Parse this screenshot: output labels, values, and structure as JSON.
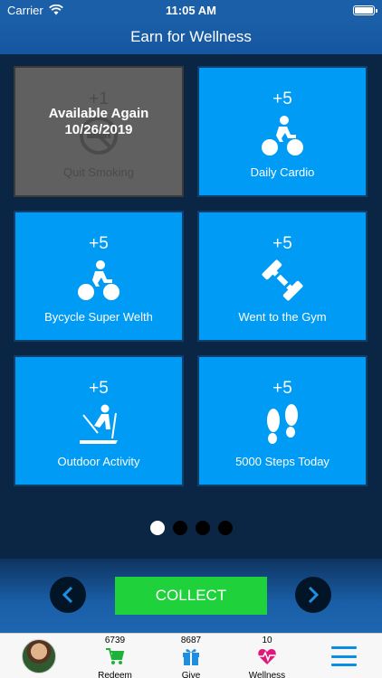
{
  "status_bar": {
    "carrier": "Carrier",
    "time": "11:05 AM"
  },
  "header": {
    "title": "Earn for Wellness"
  },
  "cards": [
    {
      "points": "+1",
      "label": "Quit Smoking",
      "icon": "no-smoking-icon",
      "overlay_line1": "Available Again",
      "overlay_line2": "10/26/2019",
      "disabled": true
    },
    {
      "points": "+5",
      "label": "Daily Cardio",
      "icon": "cycling-icon"
    },
    {
      "points": "+5",
      "label": "Bycycle Super Welth",
      "icon": "cycling-icon"
    },
    {
      "points": "+5",
      "label": "Went to the Gym",
      "icon": "dumbbell-icon"
    },
    {
      "points": "+5",
      "label": "Outdoor Activity",
      "icon": "skiing-icon"
    },
    {
      "points": "+5",
      "label": "5000 Steps Today",
      "icon": "footprints-icon"
    }
  ],
  "pagination": {
    "pages": 4,
    "current": 1
  },
  "controls": {
    "collect_label": "COLLECT"
  },
  "tabbar": {
    "redeem": {
      "count": "6739",
      "label": "Redeem",
      "icon": "cart-icon"
    },
    "give": {
      "count": "8687",
      "label": "Give",
      "icon": "gift-icon"
    },
    "wellness": {
      "count": "10",
      "label": "Wellness",
      "icon": "heartbeat-icon"
    }
  },
  "colors": {
    "card_blue": "#009bf4",
    "collect_green": "#1fd13a",
    "header_blue": "#1a5fa8",
    "wellness_pink": "#e0187a",
    "menu_blue": "#0a8de6"
  }
}
